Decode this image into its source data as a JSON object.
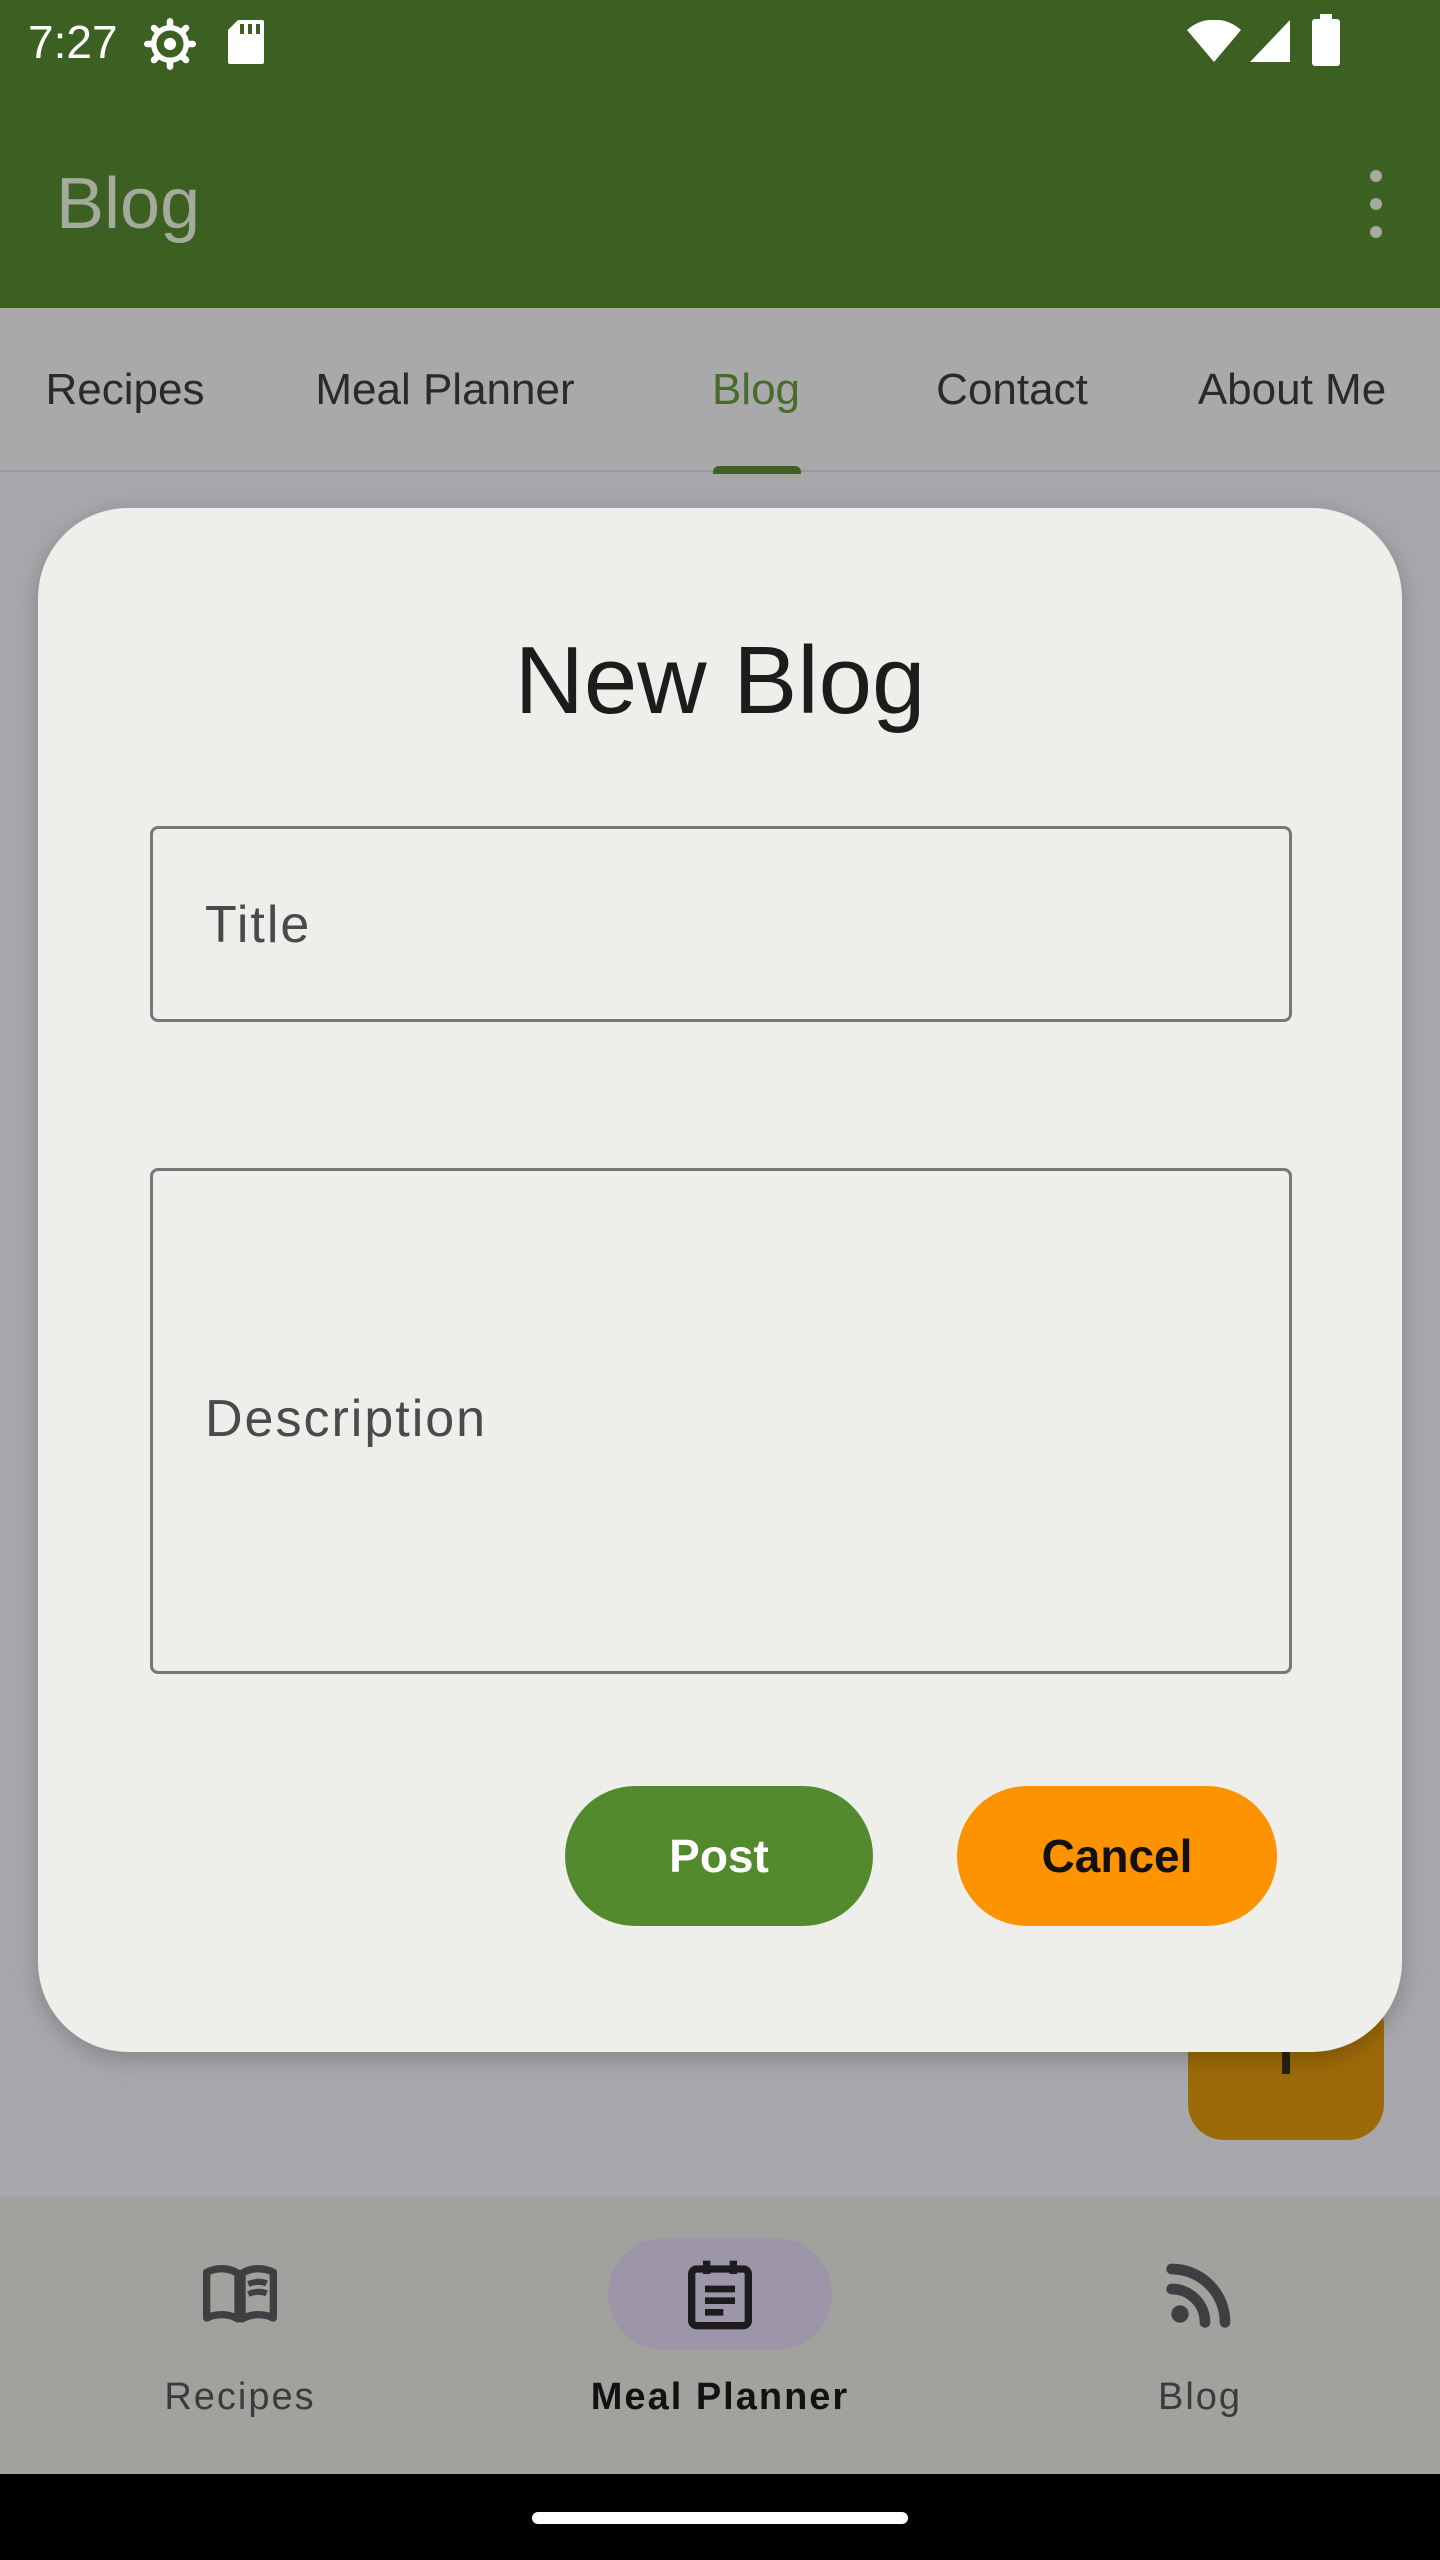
{
  "status_bar": {
    "time": "7:27",
    "icons": [
      "settings-gear-icon",
      "sd-card-icon",
      "wifi-icon",
      "cell-signal-icon",
      "battery-icon"
    ]
  },
  "app_bar": {
    "title": "Blog",
    "menu_icon": "more-vert-icon"
  },
  "tabs": [
    {
      "label": "Recipes",
      "active": false
    },
    {
      "label": "Meal Planner",
      "active": false
    },
    {
      "label": "Blog",
      "active": true
    },
    {
      "label": "Contact",
      "active": false
    },
    {
      "label": "About Me",
      "active": false
    }
  ],
  "dialog": {
    "title": "New Blog",
    "title_placeholder": "Title",
    "description_placeholder": "Description",
    "post_label": "Post",
    "cancel_label": "Cancel"
  },
  "bottom_nav": [
    {
      "label": "Recipes",
      "icon": "book-open-icon",
      "active": false
    },
    {
      "label": "Meal Planner",
      "icon": "calendar-list-icon",
      "active": true
    },
    {
      "label": "Blog",
      "icon": "rss-feed-icon",
      "active": false
    }
  ],
  "colors": {
    "primary_dark": "#3c6022",
    "post_button": "#538a2e",
    "cancel_button": "#fe9300",
    "dialog_bg": "#eeeeea",
    "active_tab": "#476c2a"
  }
}
